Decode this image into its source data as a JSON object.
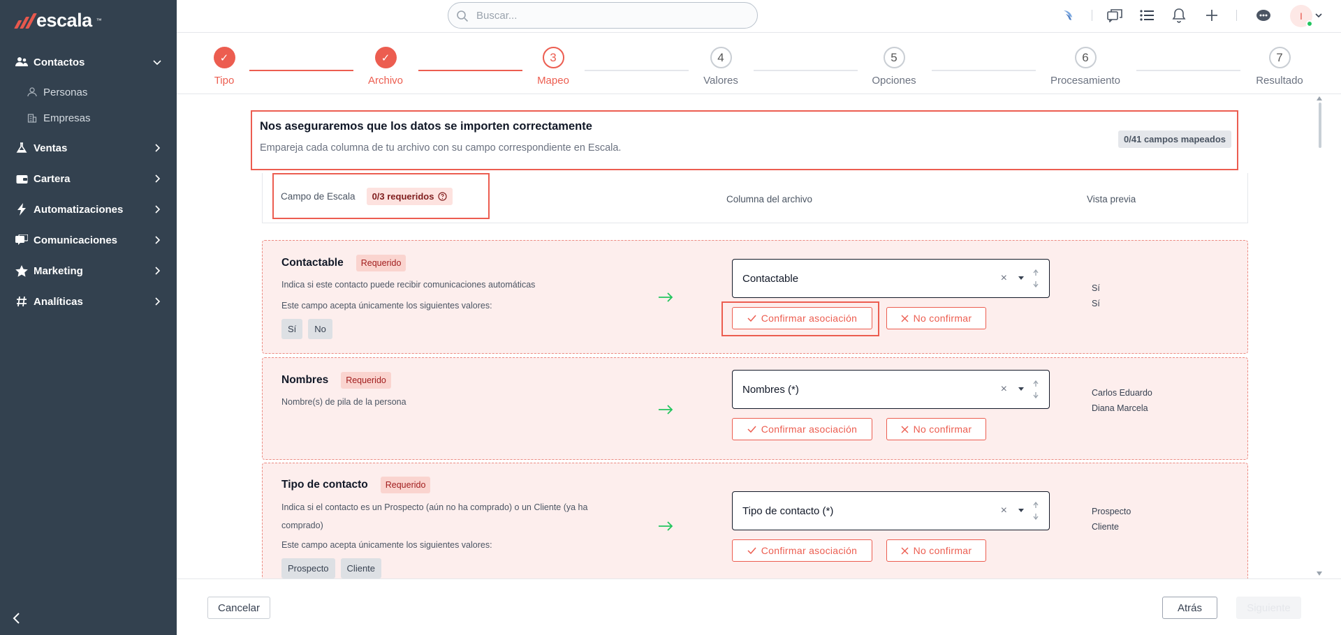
{
  "brand": {
    "name": "escala",
    "tm": "™"
  },
  "sidebar": {
    "items": [
      {
        "label": "Contactos",
        "icon": "users-icon"
      },
      {
        "label": "Ventas",
        "icon": "flask-icon"
      },
      {
        "label": "Cartera",
        "icon": "wallet-icon"
      },
      {
        "label": "Automatizaciones",
        "icon": "bolt-icon"
      },
      {
        "label": "Comunicaciones",
        "icon": "chat-icon"
      },
      {
        "label": "Marketing",
        "icon": "star-icon"
      },
      {
        "label": "Analíticas",
        "icon": "hashtag-icon"
      }
    ],
    "subitems": [
      {
        "label": "Personas",
        "icon": "person-icon"
      },
      {
        "label": "Empresas",
        "icon": "building-icon"
      }
    ]
  },
  "search": {
    "placeholder": "Buscar..."
  },
  "user": {
    "initial": "I"
  },
  "steps": [
    {
      "num": "1",
      "label": "Tipo",
      "state": "done"
    },
    {
      "num": "2",
      "label": "Archivo",
      "state": "done"
    },
    {
      "num": "3",
      "label": "Mapeo",
      "state": "current"
    },
    {
      "num": "4",
      "label": "Valores",
      "state": "todo"
    },
    {
      "num": "5",
      "label": "Opciones",
      "state": "todo"
    },
    {
      "num": "6",
      "label": "Procesamiento",
      "state": "todo"
    },
    {
      "num": "7",
      "label": "Resultado",
      "state": "todo"
    }
  ],
  "summary": {
    "title": "Nos aseguraremos que los datos se importen correctamente",
    "subtitle": "Empareja cada columna de tu archivo con su campo correspondiente en Escala.",
    "counter": "0/41 campos mapeados"
  },
  "table_header": {
    "field": "Campo de Escala",
    "required": "0/3 requeridos",
    "column": "Columna del archivo",
    "preview": "Vista previa"
  },
  "fields": [
    {
      "title": "Contactable",
      "badge": "Requerido",
      "desc": "Indica si este contacto puede recibir comunicaciones automáticas",
      "values_label": "Este campo acepta únicamente los siguientes valores:",
      "values": [
        "Sí",
        "No"
      ],
      "selected": "Contactable",
      "preview": [
        "Sí",
        "Sí"
      ]
    },
    {
      "title": "Nombres",
      "badge": "Requerido",
      "desc": "Nombre(s) de pila de la persona",
      "selected": "Nombres (*)",
      "preview": [
        "Carlos Eduardo",
        "Diana Marcela"
      ]
    },
    {
      "title": "Tipo de contacto",
      "badge": "Requerido",
      "desc": "Indica si el contacto es un Prospecto (aún no ha comprado) o un Cliente (ya ha comprado)",
      "values_label": "Este campo acepta únicamente los siguientes valores:",
      "values": [
        "Prospecto",
        "Cliente"
      ],
      "selected": "Tipo de contacto (*)",
      "preview": [
        "Prospecto",
        "Cliente"
      ]
    }
  ],
  "actions": {
    "confirm": "Confirmar asociación",
    "reject": "No confirmar",
    "clear": "×"
  },
  "footer": {
    "cancel": "Cancelar",
    "back": "Atrás",
    "next": "Siguiente"
  },
  "colors": {
    "accent": "#ec5d50",
    "sidebar": "#33414f",
    "card_bg": "#fdeeed",
    "success_arrow": "#22c55e"
  }
}
